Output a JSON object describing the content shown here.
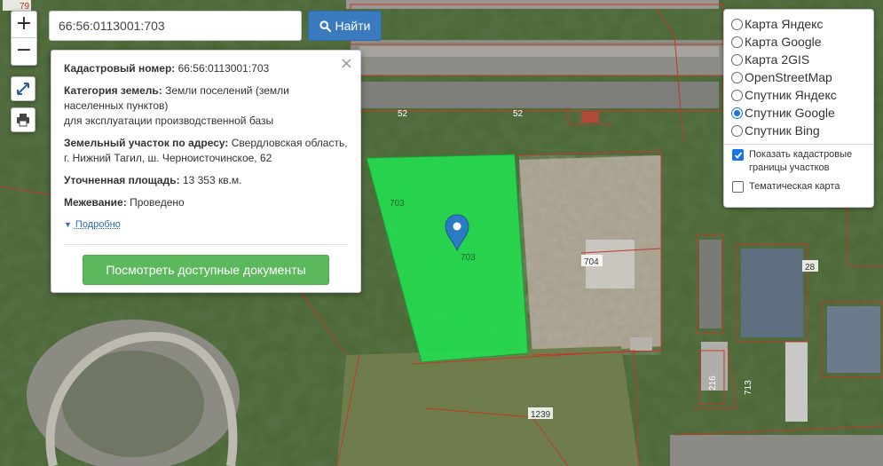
{
  "search": {
    "value": "66:56:0113001:703",
    "button_label": "Найти"
  },
  "zoom": {
    "in": "+",
    "out": "−"
  },
  "popup": {
    "cadastral_label": "Кадастровый номер:",
    "cadastral_value": "66:56:0113001:703",
    "category_label": "Категория земель:",
    "category_value_line1": "Земли поселений (земли",
    "category_value_line2": "населенных пунктов)",
    "category_value_line3": "для эксплуатации производственной базы",
    "address_label": "Земельный участок по адресу:",
    "address_value_line1": "Свердловская область,",
    "address_value_line2": "г. Нижний Тагил, ш. Черноисточинское, 62",
    "area_label": "Уточненная площадь:",
    "area_value": "13 353 кв.м.",
    "survey_label": "Межевание:",
    "survey_value": "Проведено",
    "more_link": "Подробно",
    "docs_button": "Посмотреть доступные документы",
    "close": "×"
  },
  "layers": {
    "base_maps": [
      {
        "label": "Карта Яндекс",
        "selected": false
      },
      {
        "label": "Карта Google",
        "selected": false
      },
      {
        "label": "Карта 2GIS",
        "selected": false
      },
      {
        "label": "OpenStreetMap",
        "selected": false
      },
      {
        "label": "Спутник Яндекс",
        "selected": false
      },
      {
        "label": "Спутник Google",
        "selected": true
      },
      {
        "label": "Спутник Bing",
        "selected": false
      }
    ],
    "overlays": [
      {
        "label_line1": "Показать кадастровые",
        "label_line2": "границы участков",
        "checked": true
      },
      {
        "label_line1": "Тематическая карта",
        "label_line2": "",
        "checked": false
      }
    ]
  },
  "map_labels": {
    "top_79": "79",
    "p52a": "52",
    "p52b": "52",
    "p703a": "703",
    "p703b": "703",
    "p704": "704",
    "p28": "28",
    "p216": "216",
    "p713": "713",
    "p1239": "1239"
  },
  "colors": {
    "parcel_fill": "#22e04f",
    "boundary": "#c0392b",
    "marker": "#2b7bc4",
    "search_button": "#3a7bbf",
    "docs_button": "#5cb85c"
  }
}
